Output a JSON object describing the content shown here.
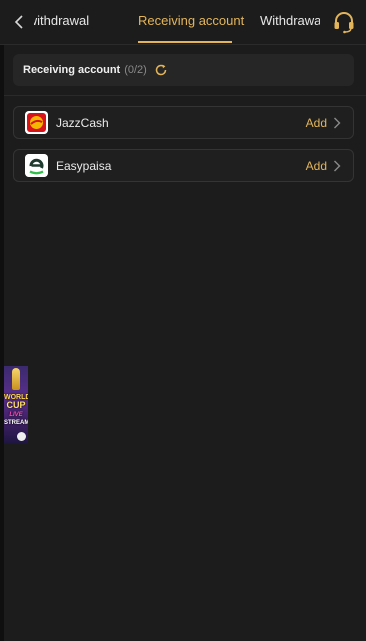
{
  "header": {
    "tabs": [
      {
        "label": "st withdrawal"
      },
      {
        "label": "Receiving account"
      },
      {
        "label": "Withdrawal r"
      }
    ],
    "active_tab_index": 1,
    "back_icon": "chevron-left-icon",
    "support_icon": "headset-icon"
  },
  "account_bar": {
    "title": "Receiving account",
    "count": "(0/2)",
    "refresh_icon": "refresh-icon"
  },
  "wallets": [
    {
      "name": "JazzCash",
      "action": "Add",
      "logo_icon": "jazzcash-logo"
    },
    {
      "name": "Easypaisa",
      "action": "Add",
      "logo_icon": "easypaisa-logo"
    }
  ],
  "promo": {
    "line1": "WORLD",
    "line2": "CUP",
    "line3": "LIVE",
    "line4": "STREAM"
  },
  "colors": {
    "background": "#1c1c1c",
    "accent": "#e3b55a",
    "card": "#262626",
    "border": "#343434"
  }
}
